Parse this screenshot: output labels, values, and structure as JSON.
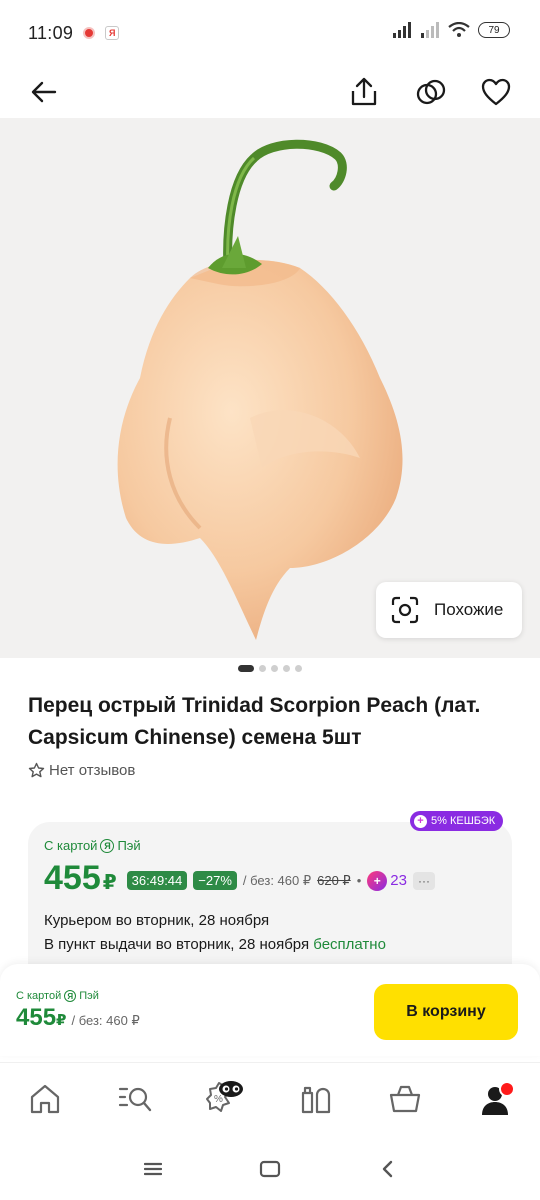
{
  "status_bar": {
    "time": "11:09",
    "battery": "79",
    "notif_ya": "Я"
  },
  "top_bar": {
    "icons": [
      "back-arrow-icon",
      "share-icon",
      "compare-icon",
      "heart-icon"
    ]
  },
  "gallery": {
    "similar_label": "Похожие",
    "dot_count": 5,
    "active_dot": 0
  },
  "product": {
    "title": "Перец острый Trinidad Scorpion Peach (лат. Capsicum Chinense) семена 5шт",
    "reviews": "Нет отзывов"
  },
  "price_card": {
    "cashback": "5% КЕШБЭК",
    "yapay_prefix": "С картой",
    "yapay_name": "Пэй",
    "ya_letter": "Я",
    "price": "455",
    "currency": "₽",
    "timer": "36:49:44",
    "discount": "−27%",
    "price_without": "/ без: 460 ₽",
    "price_old": "620 ₽",
    "separator": "•",
    "plus_points": "23",
    "more": "···"
  },
  "delivery": {
    "courier": "Курьером  во вторник, 28 ноября",
    "pickup": "В пункт выдачи  во вторник, 28 ноября",
    "pickup_free": "бесплатно"
  },
  "buy_panel": {
    "yapay_prefix": "С картой",
    "yapay_name": "Пэй",
    "ya_letter": "Я",
    "price": "455",
    "currency": "₽",
    "price_without": "/ без: 460 ₽",
    "cart_button": "В корзину"
  },
  "tab_bar": {
    "tabs": [
      "home-icon",
      "catalog-search-icon",
      "discounts-icon",
      "orders-icon",
      "cart-icon",
      "profile-icon"
    ]
  },
  "colors": {
    "accent_green": "#1f8a3a",
    "cart_yellow": "#ffe000",
    "plus_purple": "#8a2be2"
  }
}
